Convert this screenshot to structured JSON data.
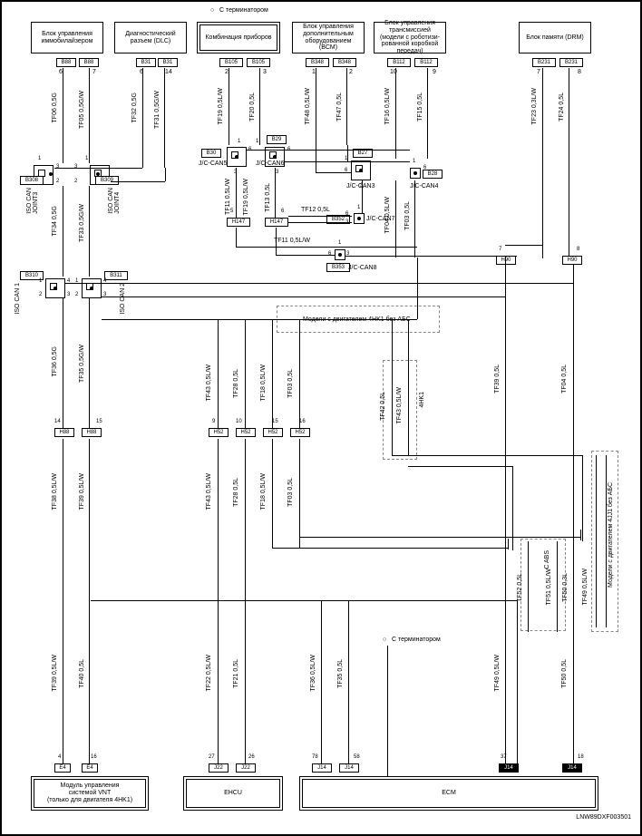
{
  "header": {
    "terminator_top": "С терминатором",
    "terminator_bottom": "С терминатором"
  },
  "top_modules": {
    "immobilizer": "Блок управления\nиммобилайзером",
    "diag_connector": "Диагностический\nразъем (DLC)",
    "instrument_combo": "Комбинация приборов",
    "bcm": "Блок управления\nдополнительным\nоборудованием\n(BCM)",
    "transmission": "Блок управления\nтрансмиссией\n(модели с роботизи-\nрованной коробкой\nпередач)",
    "drm": "Блок памяти (DRM)"
  },
  "top_pins": {
    "immo_l": "B88",
    "immo_r": "B88",
    "diag_l": "B31",
    "diag_r": "B31",
    "combo_l": "B105",
    "combo_r": "B105",
    "bcm_l": "B348",
    "bcm_r": "B348",
    "trans_l": "B112",
    "trans_r": "B112",
    "drm_l": "B231",
    "drm_r": "B231"
  },
  "top_pin_nums": {
    "immo_l": "6",
    "immo_r": "7",
    "diag_l": "6",
    "diag_r": "14",
    "combo_l": "2",
    "combo_r": "3",
    "bcm_l": "1",
    "bcm_r": "2",
    "trans_l": "10",
    "trans_r": "9",
    "drm_l": "7",
    "drm_r": "8"
  },
  "iso_can": {
    "b308": "B308",
    "b309": "B309",
    "joint3": "ISO CAN\nJOINT3",
    "joint4": "ISO CAN\nJOINT4",
    "iso_can1": "ISO CAN 1",
    "b310": "B310",
    "iso_can2": "ISO CAN 2",
    "b311": "B311"
  },
  "mid_connectors": {
    "b30": "B30",
    "b29": "B29",
    "jc_can5": "J/C-CAN5",
    "jc_can6": "J/C-CAN6",
    "b27": "B27",
    "b28": "B28",
    "jc_can3": "J/C-CAN3",
    "jc_can4": "J/C-CAN4",
    "b352": "B352",
    "jc_can7": "J/C-CAN7",
    "b353": "B353",
    "jc_can8": "J/C-CAN8",
    "h147_l": "H147",
    "h147_r": "H147"
  },
  "h_connectors": {
    "h88_l": "H88",
    "h88_r": "H88",
    "h52_1": "H52",
    "h52_2": "H52",
    "h52_3": "H52",
    "h52_4": "H52",
    "h90_l": "H90",
    "h90_r": "H90"
  },
  "h_pin_nums": {
    "h88_l": "14",
    "h88_r": "15",
    "h52_1": "9",
    "h52_2": "10",
    "h52_3": "15",
    "h52_4": "16",
    "h90_l": "7",
    "h90_r": "8"
  },
  "wire_labels": {
    "tf06_05g": "TF06  0,5G",
    "tf05_05gw": "TF05  0,5G/W",
    "tf34_05g": "TF34  0,5G",
    "tf33_05gw": "TF33  0,5G/W",
    "tf32_05g": "TF32  0,5G",
    "tf31_05gw": "TF31  0,5G/W",
    "tf19_05lw": "TF19  0,5L/W",
    "tf20_05l": "TF20  0,5L",
    "tf48_05lw": "TF48  0,5L/W",
    "tf47_05l": "TF47  0,5L",
    "tf16_05lw": "TF16  0,5L/W",
    "tf15_05l": "TF15  0,5L",
    "tf23_03lw": "TF23  0,3L/W",
    "tf24_05l": "TF24  0,5L",
    "tf11_05lw": "TF11  0,5L/W",
    "tf13_05l": "TF13  0,5L",
    "tf04_05lw": "TF04  0,5L/W",
    "tf03_05l": "TF03  0,5L",
    "tf12_05l": "TF12  0,5L",
    "tf11_05lw_b": "TF11  0,5L/W",
    "tf36_05g": "TF36  0,5G",
    "tf35_05gw": "TF35  0,5G/W",
    "tf43_05lw": "TF43  0,5L/W",
    "tf28_05l": "TF28  0,5L",
    "tf18_05lw": "TF18  0,5L/W",
    "tf03_05l_b": "TF03  0,5L",
    "tf42_05l": "TF42  0,5L",
    "tf43_05lw_b": "TF43  0,5L/W",
    "tf04_05l": "TF04  0,5L",
    "tf39_05l": "TF39  0,5L",
    "c_abs": "C ABS",
    "tf51_05lw": "TF51  0,5L/W",
    "tf52_05l": "TF52  0,5L",
    "tf50_03l": "TF50  0,3L",
    "tf49_05lw_top": "TF49  0,5L/W",
    "tf38_05lw": "TF38  0,5L/W",
    "tf39_05lw": "TF39  0,5L/W",
    "tf40_05l": "TF40  0,5L",
    "tf22_05lw": "TF22  0,5L/W",
    "tf21_05l": "TF21  0,5L",
    "tf36_05lw": "TF36  0,5L/W",
    "tf35_05l": "TF35  0,5L",
    "tf49_05lw": "TF49  0,5L/W",
    "tf50_05l": "TF50  0,5L"
  },
  "dashed_notes": {
    "engine_4hk1_no_abs": "Модели с двигателем 4HK1 без АБС",
    "engine_4hk1": "4HK1",
    "engine_4jj1_no_abs": "Модели с двигателем 4JJ1 без АБС"
  },
  "bottom_modules": {
    "vnt": "Модуль управления\nсистемой VNT\n(только для двигателя 4HK1)",
    "ehcu": "EHCU",
    "ecm": "ECM"
  },
  "bottom_pins": {
    "e4_l": "E4",
    "e4_r": "E4",
    "j22_l": "J22",
    "j22_r": "J22",
    "j14_1": "J14",
    "j14_2": "J14",
    "j14_3": "J14",
    "j14_4": "J14"
  },
  "bottom_pin_nums": {
    "e4_l": "4",
    "e4_r": "16",
    "j22_l": "27",
    "j22_r": "26",
    "j14_1": "78",
    "j14_2": "58",
    "j14_3": "37",
    "j14_4": "18"
  },
  "part_number": "LNW89DXF003501"
}
